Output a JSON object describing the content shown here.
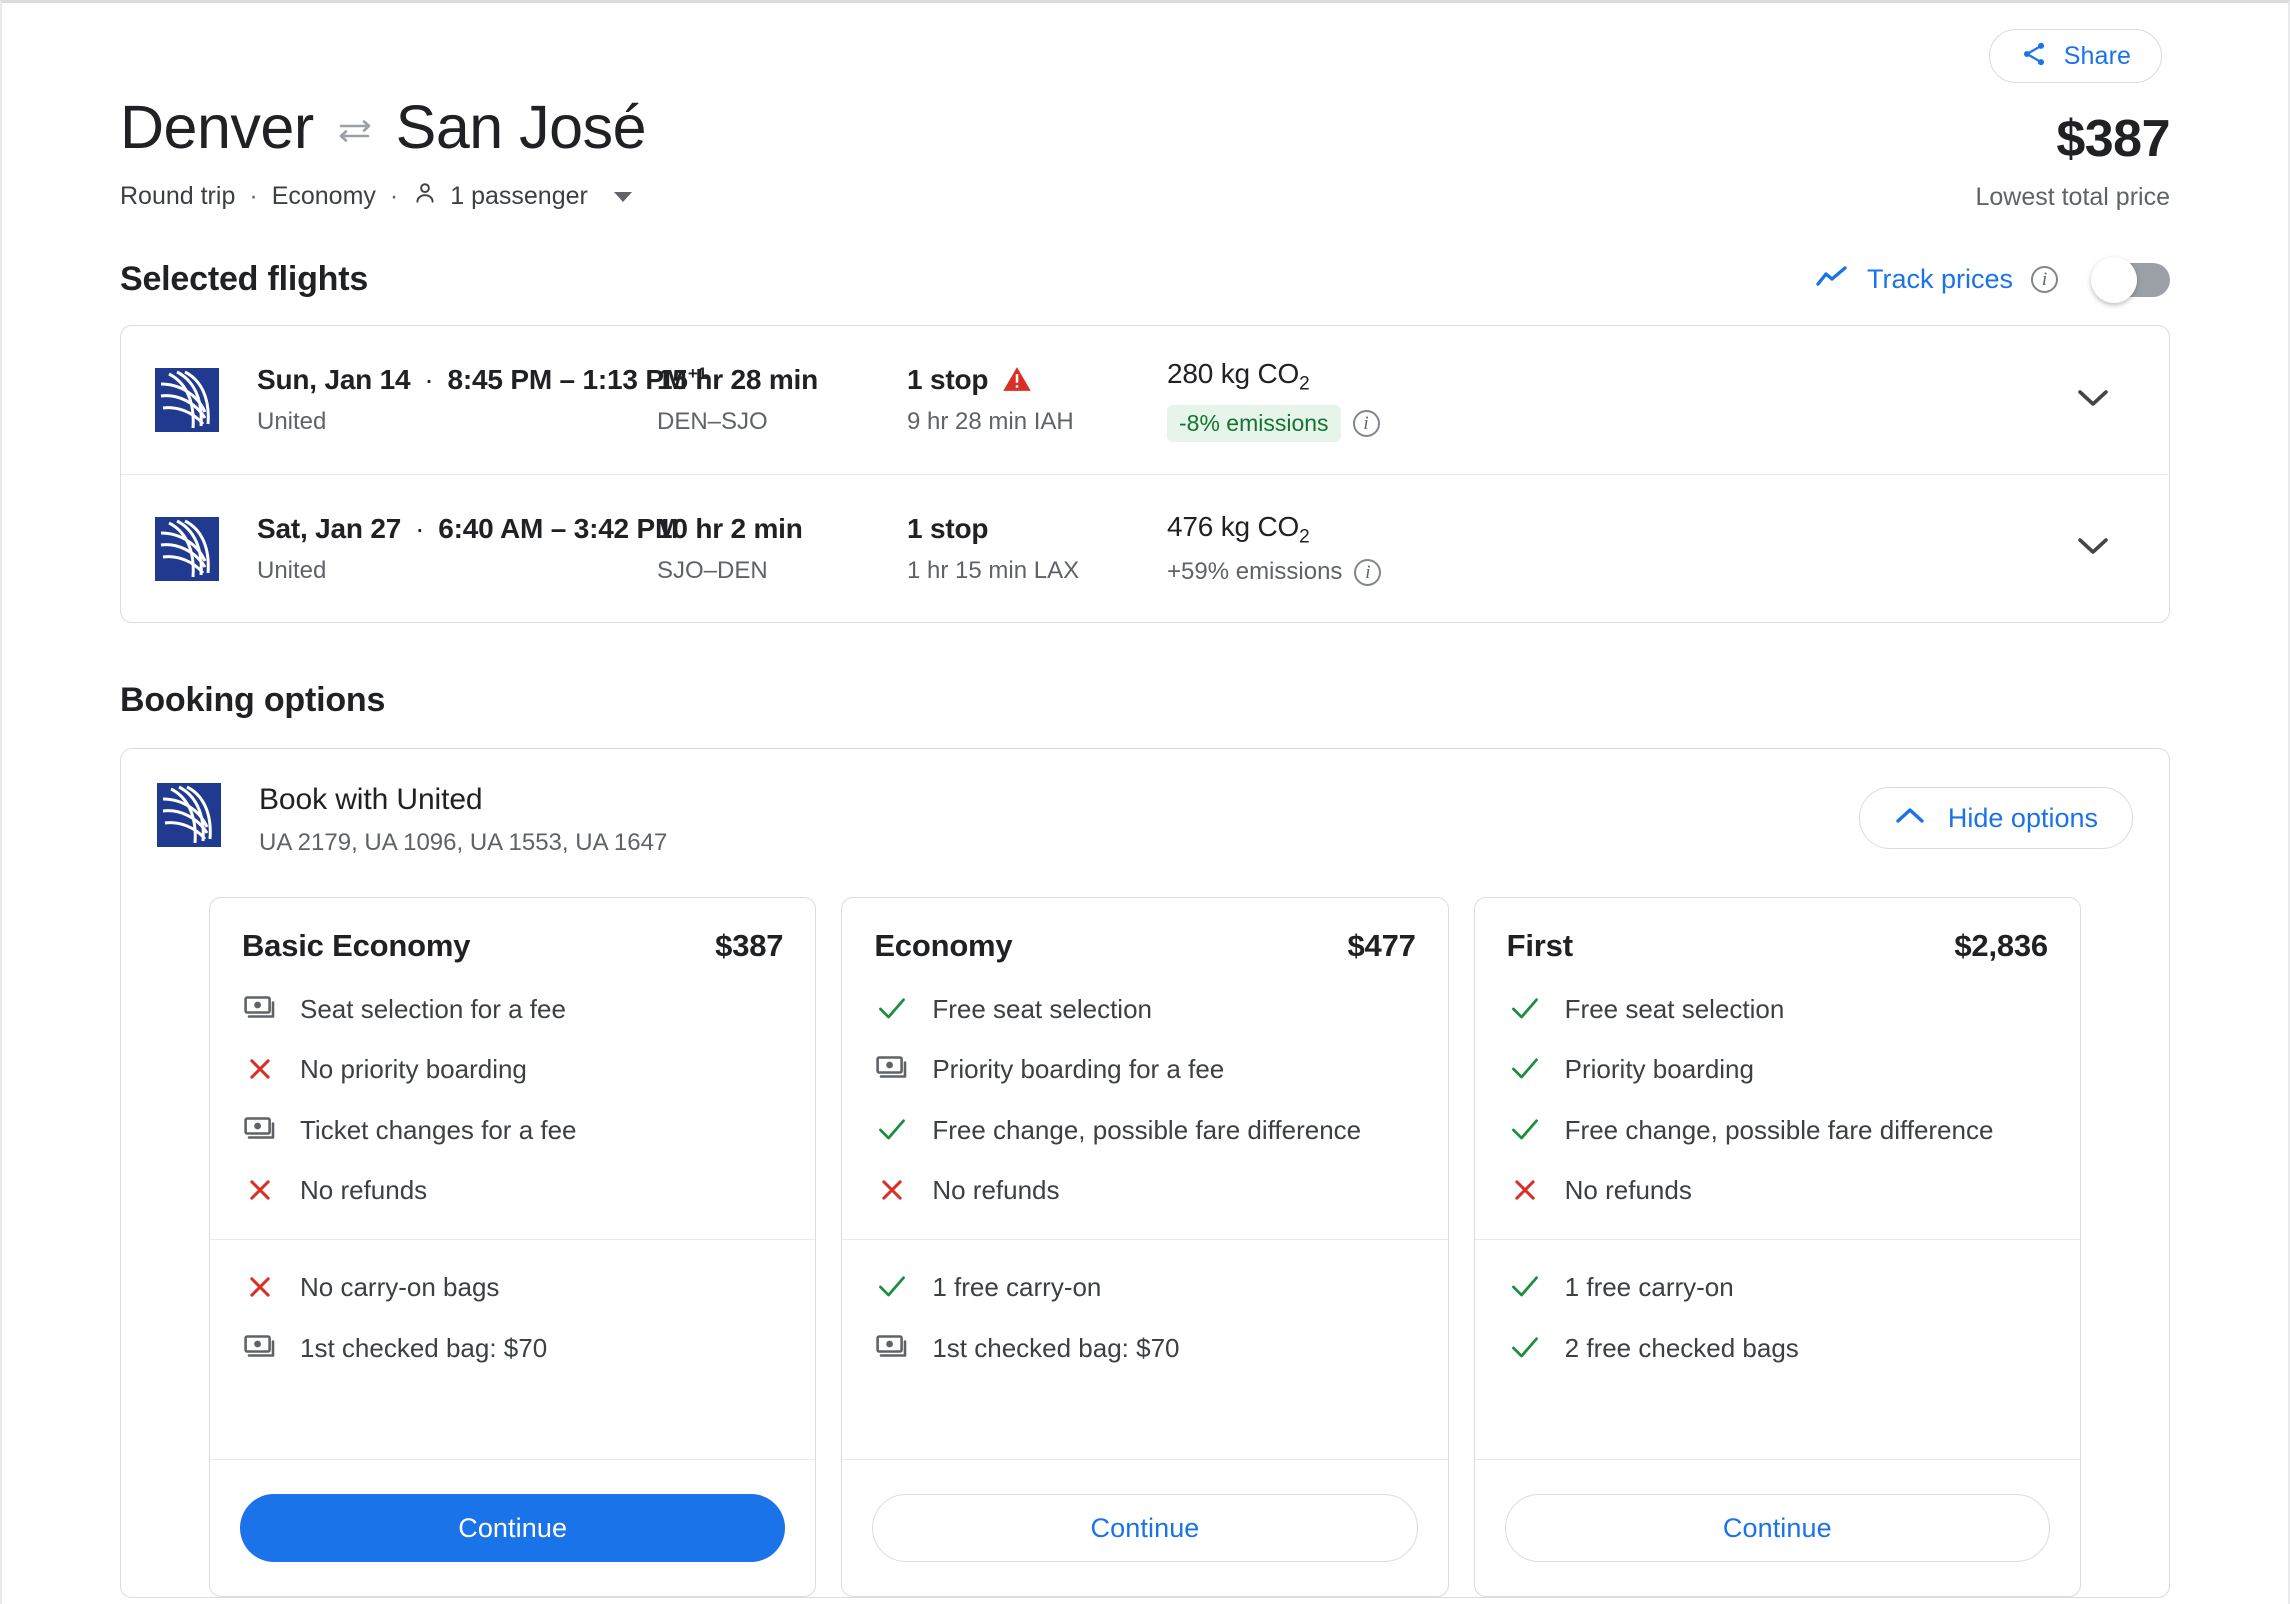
{
  "share": {
    "label": "Share",
    "icon": "share-icon"
  },
  "header": {
    "origin": "Denver",
    "swap_icon": "swap-arrows-icon",
    "destination": "San José",
    "trip_type": "Round trip",
    "separator": "·",
    "cabin": "Economy",
    "passengers": "1 passenger",
    "person_icon": "person-icon",
    "price": "$387",
    "price_caption": "Lowest total price"
  },
  "selected_flights": {
    "title": "Selected flights",
    "track_prices": {
      "label": "Track prices",
      "trend_icon": "trending-up-icon",
      "info_icon": "info-icon",
      "toggle_state": "off"
    },
    "rows": [
      {
        "airline_logo": "united-logo",
        "date": "Sun, Jan 14",
        "dot": "·",
        "times": "8:45 PM – 1:13 PM",
        "day_offset": "+1",
        "airline": "United",
        "duration": "15 hr 28 min",
        "route": "DEN–SJO",
        "stops": "1 stop",
        "warning_icon": "warning-triangle-icon",
        "has_warning": true,
        "layover": "9 hr 28 min IAH",
        "co2": "280 kg CO",
        "co2_sub": "2",
        "emissions": "-8% emissions",
        "emissions_style": "badge-green",
        "emissions_info_icon": "info-icon",
        "chevron_icon": "chevron-down-icon"
      },
      {
        "airline_logo": "united-logo",
        "date": "Sat, Jan 27",
        "dot": "·",
        "times": "6:40 AM – 3:42 PM",
        "day_offset": "",
        "airline": "United",
        "duration": "10 hr 2 min",
        "route": "SJO–DEN",
        "stops": "1 stop",
        "warning_icon": "",
        "has_warning": false,
        "layover": "1 hr 15 min LAX",
        "co2": "476 kg CO",
        "co2_sub": "2",
        "emissions": "+59% emissions",
        "emissions_style": "plain-gray",
        "emissions_info_icon": "info-icon",
        "chevron_icon": "chevron-down-icon"
      }
    ]
  },
  "booking_options": {
    "title": "Booking options",
    "provider": {
      "logo": "united-logo",
      "title": "Book with United",
      "flight_numbers": "UA 2179, UA 1096, UA 1553, UA 1647"
    },
    "hide_button": {
      "label": "Hide options",
      "icon": "chevron-up-icon"
    },
    "fares": [
      {
        "name": "Basic Economy",
        "price": "$387",
        "features": [
          {
            "icon": "money-fee-icon",
            "text": "Seat selection for a fee"
          },
          {
            "icon": "red-x-icon",
            "text": "No priority boarding"
          },
          {
            "icon": "money-fee-icon",
            "text": "Ticket changes for a fee"
          },
          {
            "icon": "red-x-icon",
            "text": "No refunds"
          }
        ],
        "bags": [
          {
            "icon": "red-x-icon",
            "text": "No carry-on bags"
          },
          {
            "icon": "money-fee-icon",
            "text": "1st checked bag: $70"
          }
        ],
        "button": {
          "label": "Continue",
          "style": "filled"
        }
      },
      {
        "name": "Economy",
        "price": "$477",
        "features": [
          {
            "icon": "green-check-icon",
            "text": "Free seat selection"
          },
          {
            "icon": "money-fee-icon",
            "text": "Priority boarding for a fee"
          },
          {
            "icon": "green-check-icon",
            "text": "Free change, possible fare difference"
          },
          {
            "icon": "red-x-icon",
            "text": "No refunds"
          }
        ],
        "bags": [
          {
            "icon": "green-check-icon",
            "text": "1 free carry-on"
          },
          {
            "icon": "money-fee-icon",
            "text": "1st checked bag: $70"
          }
        ],
        "button": {
          "label": "Continue",
          "style": "outline"
        }
      },
      {
        "name": "First",
        "price": "$2,836",
        "features": [
          {
            "icon": "green-check-icon",
            "text": "Free seat selection"
          },
          {
            "icon": "green-check-icon",
            "text": "Priority boarding"
          },
          {
            "icon": "green-check-icon",
            "text": "Free change, possible fare difference"
          },
          {
            "icon": "red-x-icon",
            "text": "No refunds"
          }
        ],
        "bags": [
          {
            "icon": "green-check-icon",
            "text": "1 free carry-on"
          },
          {
            "icon": "green-check-icon",
            "text": "2 free checked bags"
          }
        ],
        "button": {
          "label": "Continue",
          "style": "outline"
        }
      }
    ]
  },
  "colors": {
    "accent_blue": "#1a73e8",
    "united_navy": "#1f3a8f",
    "green_check": "#1e8e3e",
    "red_x": "#d93025",
    "emissions_green_bg": "#e6f4ea",
    "emissions_green_text": "#137333",
    "warning_red": "#d93025"
  }
}
